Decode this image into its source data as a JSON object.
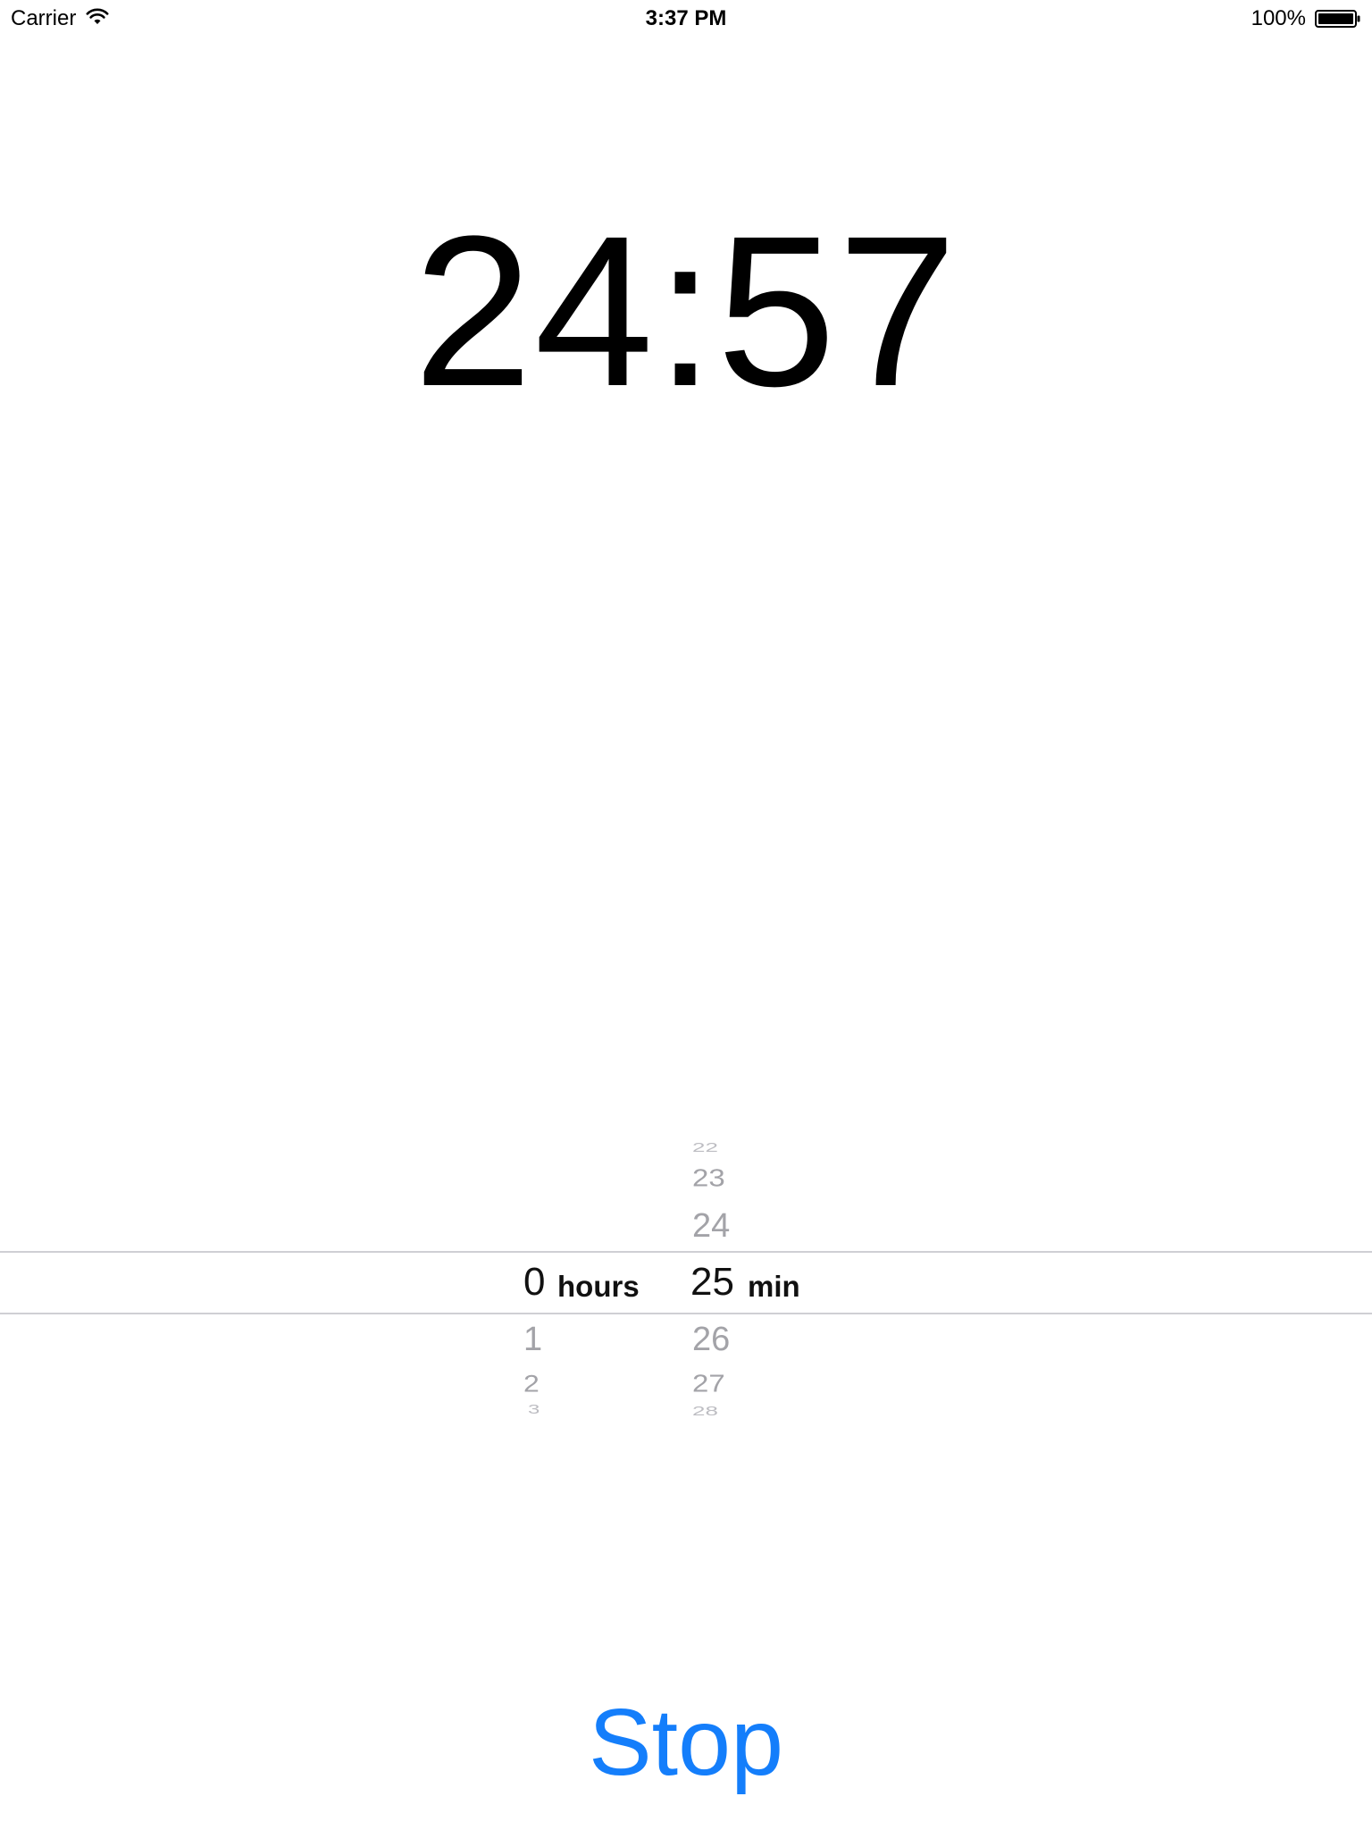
{
  "status_bar": {
    "carrier": "Carrier",
    "time": "3:37 PM",
    "battery_percent": "100%",
    "wifi_icon": "wifi-icon",
    "battery_icon": "battery-icon"
  },
  "timer": {
    "countdown": "24:57"
  },
  "picker": {
    "hours": {
      "unit_label": "hours",
      "selected": "0",
      "above": [],
      "below": [
        "1",
        "2",
        "3"
      ]
    },
    "minutes": {
      "unit_label": "min",
      "selected": "25",
      "above": [
        "22",
        "23",
        "24"
      ],
      "below": [
        "26",
        "27",
        "28"
      ]
    }
  },
  "actions": {
    "stop_label": "Stop"
  },
  "colors": {
    "accent": "#147efb",
    "picker_inactive": "#a3a3a8",
    "separator": "#cfcfd4"
  }
}
